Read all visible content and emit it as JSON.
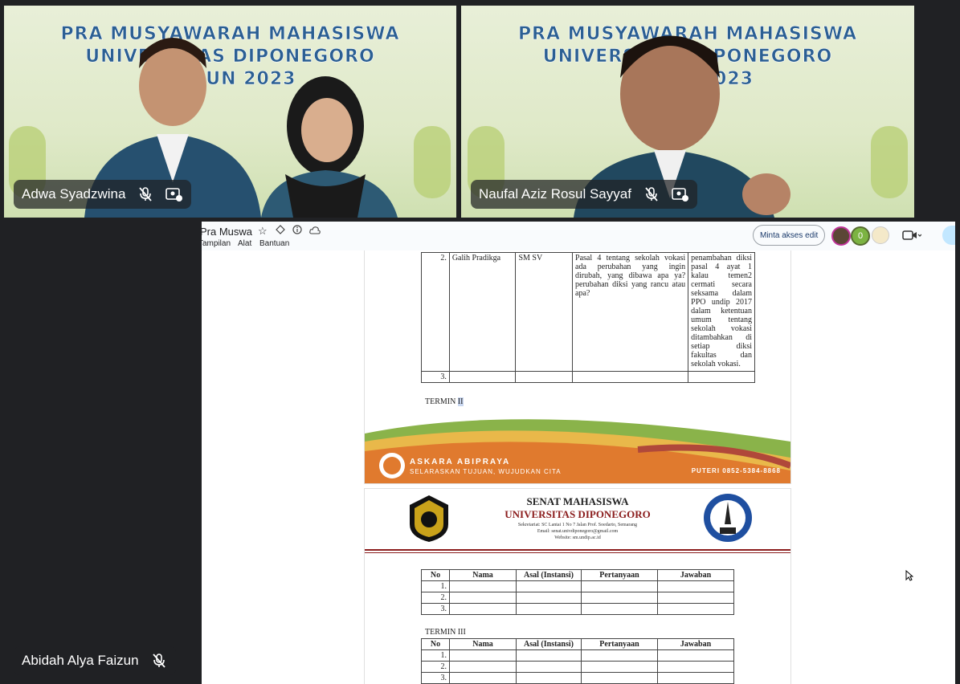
{
  "tiles": {
    "top_left": {
      "name": "Adwa Syadzwina",
      "banner": [
        "PRA MUSYAWARAH MAHASISWA",
        "UNIVERSITAS DIPONEGORO",
        "TAHUN 2023"
      ]
    },
    "top_right": {
      "name": "Naufal Aziz Rosul Sayyaf",
      "banner": [
        "PRA MUSYAWARAH MAHASISWA",
        "UNIVERSITAS DIPONEGORO",
        "TAHUN 2023"
      ]
    },
    "bottom_left": {
      "name": "Abidah Alya Faizun"
    }
  },
  "docs": {
    "title": "Pra Muswa",
    "menu": [
      "Tampilan",
      "Alat",
      "Bantuan"
    ],
    "request_edit": "Minta akses edit",
    "viewer_count": "0",
    "row2": {
      "no": "2.",
      "nama": "Galih Pradikga",
      "asal": "SM SV",
      "pertanyaan": "Pasal 4 tentang sekolah vokasi ada perubahan yang ingin dirubah, yang dibawa apa ya? perubahan diksi yang rancu atau apa?",
      "jawaban": "penambahan diksi pasal 4 ayat 1 kalau temen2 cermati secara seksama dalam PPO undip 2017 dalam ketentuan umum tentang sekolah vokasi ditambahkan di setiap diksi fakultas dan sekolah vokasi."
    },
    "row3_no": "3.",
    "termin2": "TERMIN II",
    "footer_banner": {
      "title": "ASKARA ABIPRAYA",
      "subtitle": "SELARASKAN TUJUAN, WUJUDKAN CITA",
      "contact": "PUTERI 0852-5384-8868"
    },
    "letterhead": {
      "line1": "SENAT MAHASISWA",
      "line2": "UNIVERSITAS DIPONEGORO",
      "addr1": "Sekretariat: SC Lantai 1 No 7 Jalan Prof. Soedarto, Semarang",
      "addr2": "Email: senat.univdiponegoro@gmail.com",
      "addr3": "Website: sm.undip.ac.id"
    },
    "table_headers": [
      "No",
      "Nama",
      "Asal (Instansi)",
      "Pertanyaan",
      "Jawaban"
    ],
    "rows": [
      "1.",
      "2.",
      "3."
    ],
    "termin3": "TERMIN III"
  },
  "colors": {
    "accent": "#2b5f93",
    "meet_bg": "#202124",
    "banner_orange": "#e07a2e",
    "banner_green": "#8ab34a"
  }
}
